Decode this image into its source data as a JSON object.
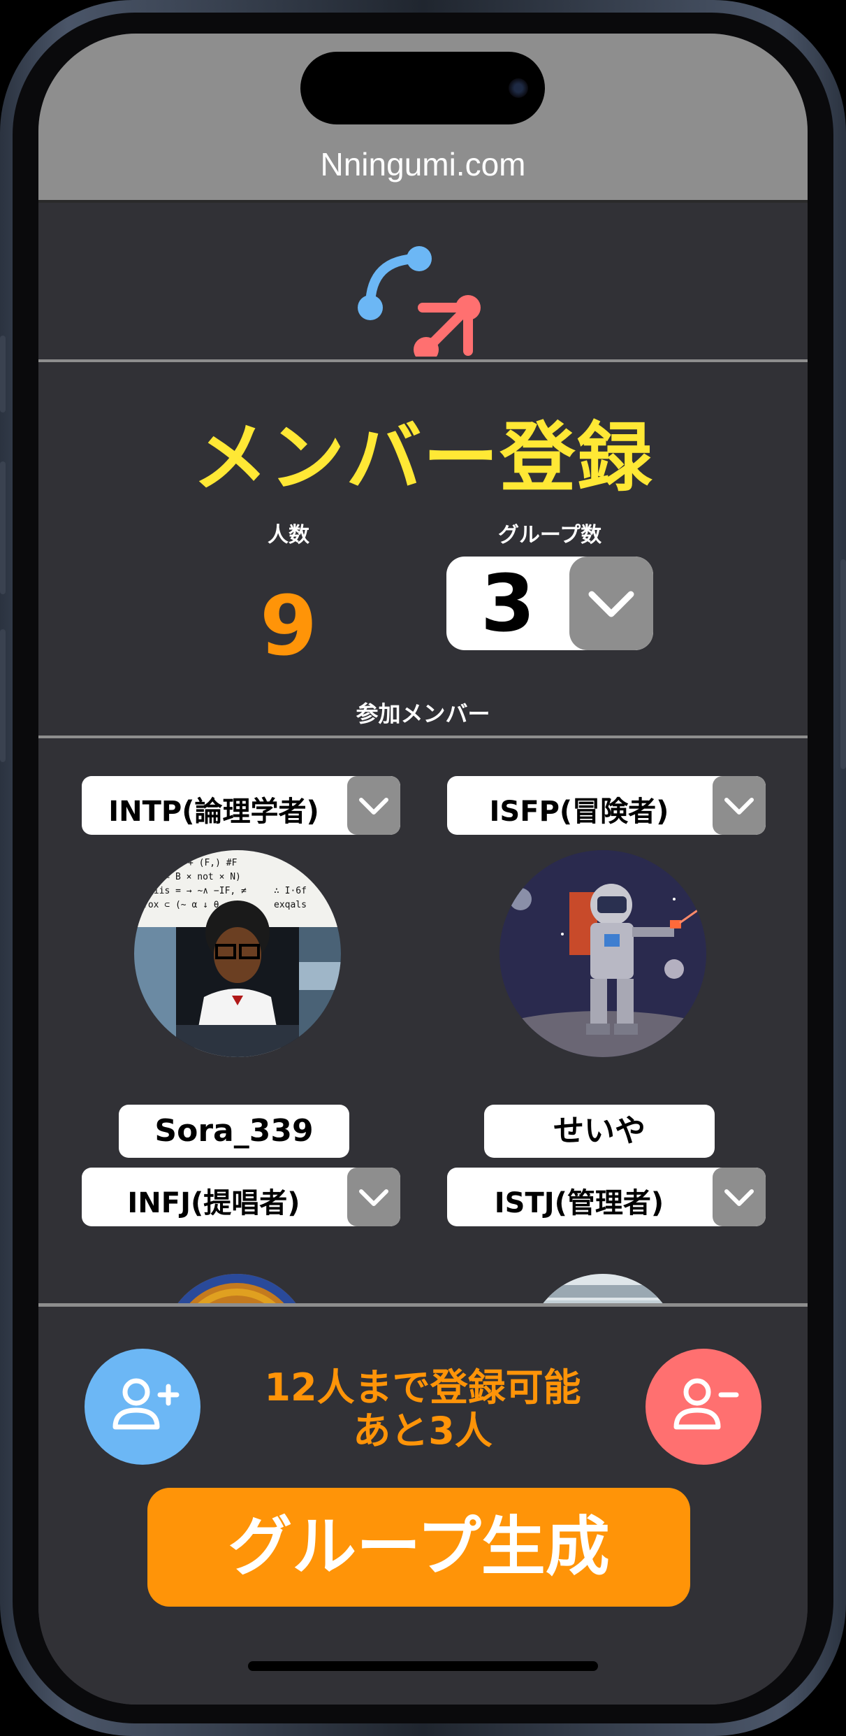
{
  "site": {
    "name": "Nningumi.com"
  },
  "page": {
    "title": "メンバー登録"
  },
  "stats": {
    "count_label": "人数",
    "count_value": "9",
    "groups_label": "グループ数",
    "groups_value": "3"
  },
  "members_section": {
    "label": "参加メンバー"
  },
  "members": [
    {
      "type": "INTP(論理学者)",
      "name": "Sora_339",
      "avatar": "thinker-avatar"
    },
    {
      "type": "ISFP(冒険者)",
      "name": "せいや",
      "avatar": "astronaut-avatar"
    },
    {
      "type": "INFJ(提唱者)",
      "name": "",
      "avatar": "stained-glass-avatar"
    },
    {
      "type": "ISTJ(管理者)",
      "name": "",
      "avatar": "computer-avatar"
    }
  ],
  "limit": {
    "line1": "12人まで登録可能",
    "line2": "あと3人"
  },
  "actions": {
    "generate_label": "グループ生成"
  },
  "colors": {
    "accent_orange": "#ff9408",
    "title_yellow": "#ffe835",
    "add_blue": "#6cb7f5",
    "remove_red": "#ff7070",
    "background": "#313136",
    "header_gray": "#8e8e8e"
  },
  "icons": {
    "add_user": "add-user-icon",
    "remove_user": "remove-user-icon",
    "dropdown": "chevron-down-icon",
    "logo": "logo-icon"
  }
}
